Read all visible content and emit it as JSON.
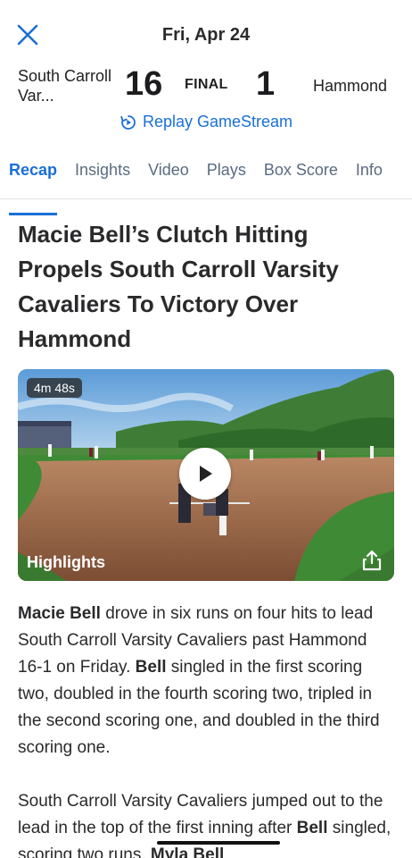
{
  "header": {
    "date": "Fri, Apr 24",
    "close_icon": "close-icon"
  },
  "score": {
    "home_team": "South Carroll Var...",
    "home_score": "16",
    "status": "FINAL",
    "away_score": "1",
    "away_team": "Hammond"
  },
  "replay": {
    "label": "Replay GameStream",
    "icon": "replay-icon"
  },
  "tabs": [
    {
      "label": "Recap",
      "active": true
    },
    {
      "label": "Insights"
    },
    {
      "label": "Video"
    },
    {
      "label": "Plays"
    },
    {
      "label": "Box Score"
    },
    {
      "label": "Info"
    }
  ],
  "headline": "Macie Bell’s Clutch Hitting Propels South Carroll Varsity Cavaliers To Victory Over Hammond",
  "video": {
    "duration": "4m 48s",
    "title": "Highlights",
    "play_icon": "play-icon",
    "share_icon": "share-icon"
  },
  "article": {
    "p1": [
      {
        "text": "Macie Bell",
        "bold": true
      },
      {
        "text": " drove in six runs on four hits to lead South Carroll Varsity Cavaliers past Hammond 16-1 on Friday. "
      },
      {
        "text": "Bell",
        "bold": true
      },
      {
        "text": " singled in the first scoring two, doubled in the fourth scoring two, tripled in the second scoring one, and doubled in the third scoring one."
      }
    ],
    "p2": [
      {
        "text": "South Carroll Varsity Cavaliers jumped out to the lead in the top of the first inning after "
      },
      {
        "text": "Bell",
        "bold": true
      },
      {
        "text": " singled, scoring two runs. "
      },
      {
        "text": "Myla Bell",
        "bold": true
      }
    ]
  },
  "colors": {
    "accent": "#1a6fd6",
    "tab_inactive": "#5a6b80",
    "text": "#2a2a2c"
  }
}
